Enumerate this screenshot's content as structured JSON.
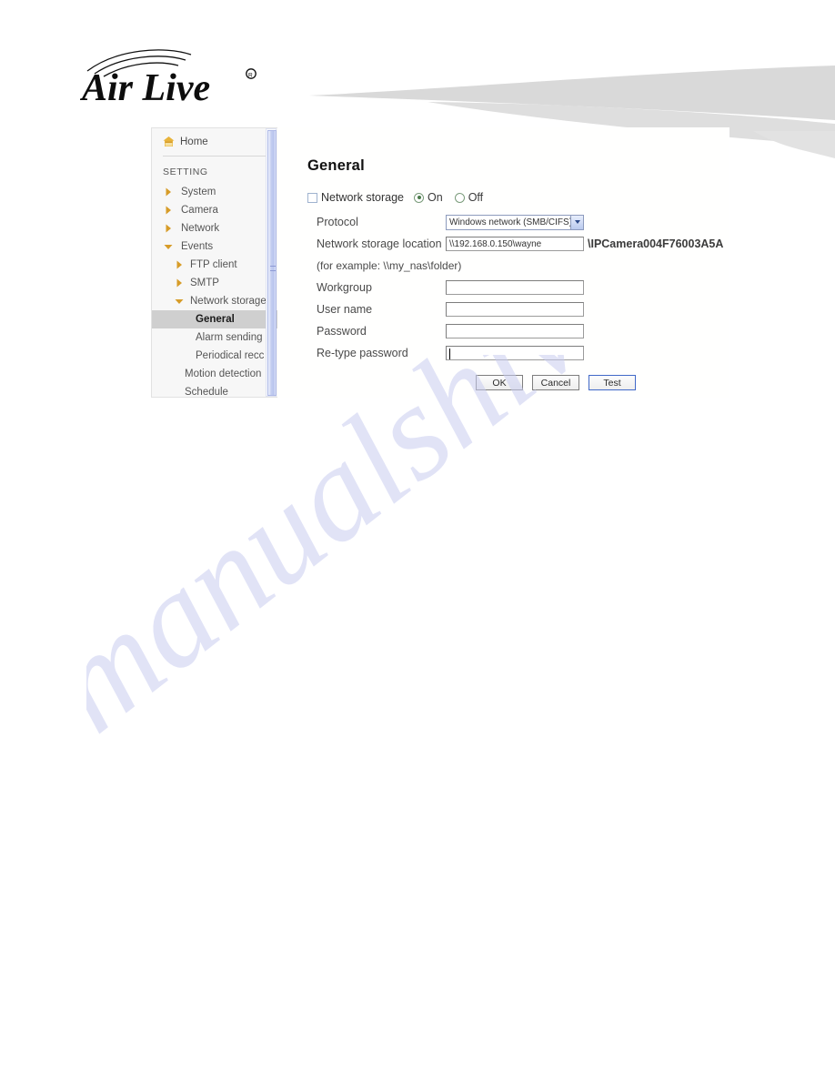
{
  "brand": {
    "logo_text": "Air Live",
    "logo_mark": "registered-trademark"
  },
  "watermark": {
    "text": "manualshive.com",
    "color": "#c9cdf0"
  },
  "sidebar": {
    "home_label": "Home",
    "section_label": "SETTING",
    "items": [
      {
        "label": "System",
        "level": 1,
        "state": "collapsed",
        "selected": false
      },
      {
        "label": "Camera",
        "level": 1,
        "state": "collapsed",
        "selected": false
      },
      {
        "label": "Network",
        "level": 1,
        "state": "collapsed",
        "selected": false
      },
      {
        "label": "Events",
        "level": 1,
        "state": "expanded",
        "selected": false
      },
      {
        "label": "FTP client",
        "level": 2,
        "state": "collapsed",
        "selected": false
      },
      {
        "label": "SMTP",
        "level": 2,
        "state": "collapsed",
        "selected": false
      },
      {
        "label": "Network storage",
        "level": 2,
        "state": "expanded",
        "selected": false
      },
      {
        "label": "General",
        "level": 3,
        "state": "leaf",
        "selected": true
      },
      {
        "label": "Alarm sending",
        "level": 3,
        "state": "leaf",
        "selected": false
      },
      {
        "label": "Periodical recc",
        "level": 3,
        "state": "leaf",
        "selected": false
      },
      {
        "label": "Motion detection",
        "level": 2,
        "state": "leaf",
        "selected": false
      },
      {
        "label": "Schedule",
        "level": 2,
        "state": "leaf",
        "selected": false
      }
    ],
    "scrollbar": {
      "thumb_color": "#c3cdf0"
    }
  },
  "content": {
    "title": "General",
    "network_storage": {
      "checkbox_label": "Network storage",
      "checkbox_checked": false,
      "radio_on_label": "On",
      "radio_off_label": "Off",
      "selected": "On"
    },
    "fields": {
      "protocol_label": "Protocol",
      "protocol_value": "Windows network (SMB/CIFS)",
      "location_label": "Network storage location",
      "location_value": "\\\\192.168.0.150\\wayne",
      "location_suffix": "\\IPCamera004F76003A5A",
      "example_hint": "(for example: \\\\my_nas\\folder)",
      "workgroup_label": "Workgroup",
      "workgroup_value": "",
      "username_label": "User name",
      "username_value": "",
      "password_label": "Password",
      "password_value": "",
      "retype_label": "Re-type password",
      "retype_value": "",
      "retype_focused": true
    },
    "buttons": {
      "ok": "OK",
      "cancel": "Cancel",
      "test": "Test"
    }
  }
}
